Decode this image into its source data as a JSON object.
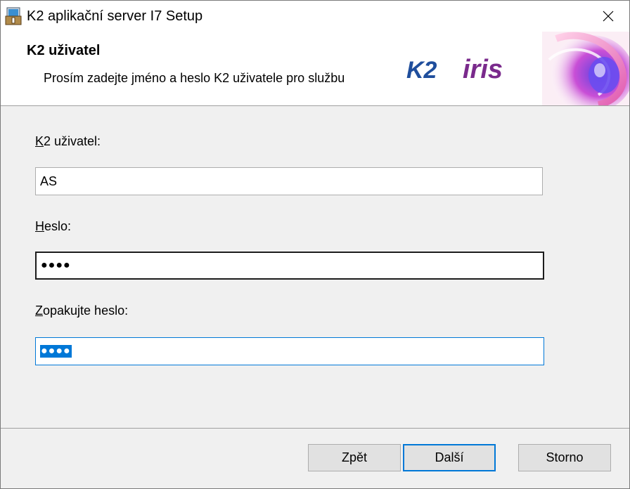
{
  "window": {
    "title": "K2 aplikační server I7 Setup"
  },
  "banner": {
    "title": "K2 uživatel",
    "description": "Prosím zadejte jméno a heslo K2 uživatele pro službu",
    "logo_k2": "K2",
    "logo_iris": "iris"
  },
  "form": {
    "user_label_access": "K",
    "user_label_rest": "2 uživatel:",
    "user_value": "AS",
    "password_label_access": "H",
    "password_label_rest": "eslo:",
    "password_masked": "●●●●",
    "confirm_label_access": "Z",
    "confirm_label_rest": "opakujte heslo:",
    "confirm_masked": "●●●●"
  },
  "buttons": {
    "back": "Zpět",
    "next": "Další",
    "cancel": "Storno"
  },
  "colors": {
    "focus": "#0078d7",
    "logo_blue": "#1f4e9c",
    "logo_purple": "#7a2a8c"
  }
}
